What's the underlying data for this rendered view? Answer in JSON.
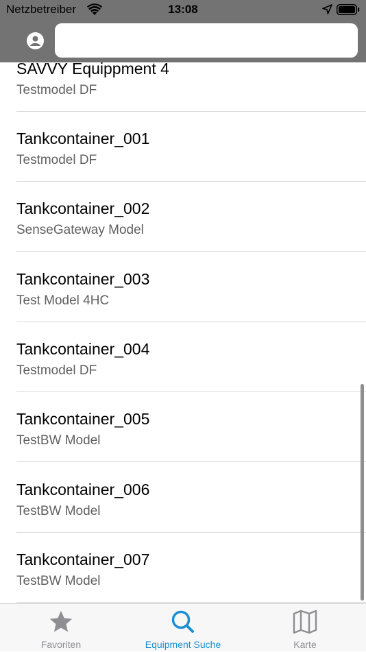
{
  "status": {
    "carrier": "Netzbetreiber",
    "time": "13:08"
  },
  "search": {
    "placeholder": ""
  },
  "list": [
    {
      "title": "SAVVY Equippment 4",
      "subtitle": "Testmodel DF"
    },
    {
      "title": "Tankcontainer_001",
      "subtitle": "Testmodel DF"
    },
    {
      "title": "Tankcontainer_002",
      "subtitle": "SenseGateway Model"
    },
    {
      "title": "Tankcontainer_003",
      "subtitle": "Test Model 4HC"
    },
    {
      "title": "Tankcontainer_004",
      "subtitle": "Testmodel DF"
    },
    {
      "title": "Tankcontainer_005",
      "subtitle": "TestBW Model"
    },
    {
      "title": "Tankcontainer_006",
      "subtitle": "TestBW Model"
    },
    {
      "title": "Tankcontainer_007",
      "subtitle": "TestBW Model"
    }
  ],
  "tabs": [
    {
      "label": "Favoriten",
      "icon": "star-icon",
      "active": false
    },
    {
      "label": "Equipment Suche",
      "icon": "search-icon",
      "active": true
    },
    {
      "label": "Karte",
      "icon": "map-icon",
      "active": false
    }
  ],
  "colors": {
    "accent": "#1a8fd1",
    "inactive": "#8e8e93",
    "header": "#737373"
  }
}
